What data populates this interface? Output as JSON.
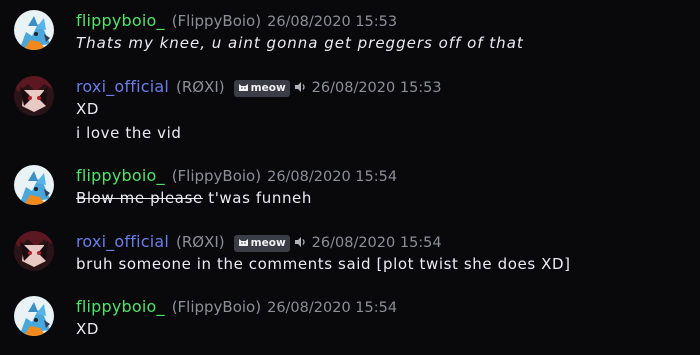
{
  "messages": [
    {
      "username": "flippyboio_",
      "nickname": "(FlippyBoio)",
      "timestamp": "26/08/2020  15:53",
      "lines": [
        "Thats my knee, u aint gonna get preggers off of that"
      ]
    },
    {
      "username": "roxi_official",
      "nickname": "(RØXI)",
      "badge": "meow",
      "timestamp": "26/08/2020  15:53",
      "lines": [
        "XD",
        "i love the vid"
      ]
    },
    {
      "username": "flippyboio_",
      "nickname": "(FlippyBoio)",
      "timestamp": "26/08/2020  15:54",
      "struck_text": "Blow me please",
      "text": " t'was funneh"
    },
    {
      "username": "roxi_official",
      "nickname": "(RØXI)",
      "badge": "meow",
      "timestamp": "26/08/2020  15:54",
      "lines": [
        "bruh someone in the comments said [plot twist she does XD]"
      ]
    },
    {
      "username": "flippyboio_",
      "nickname": "(FlippyBoio)",
      "timestamp": "26/08/2020  15:54",
      "lines": [
        "XD"
      ]
    }
  ],
  "colors": {
    "background": "#09090c",
    "username_flippy": "#4fe36a",
    "username_roxi": "#6b7de8",
    "meta_text": "#8d8f96",
    "badge_bg": "#3a3d45"
  },
  "icons": {
    "flippy_avatar": "blue-fox-avatar-icon",
    "roxi_avatar": "dark-anime-avatar-icon",
    "badge": "cat-face-icon",
    "speaker": "speaker-icon"
  }
}
